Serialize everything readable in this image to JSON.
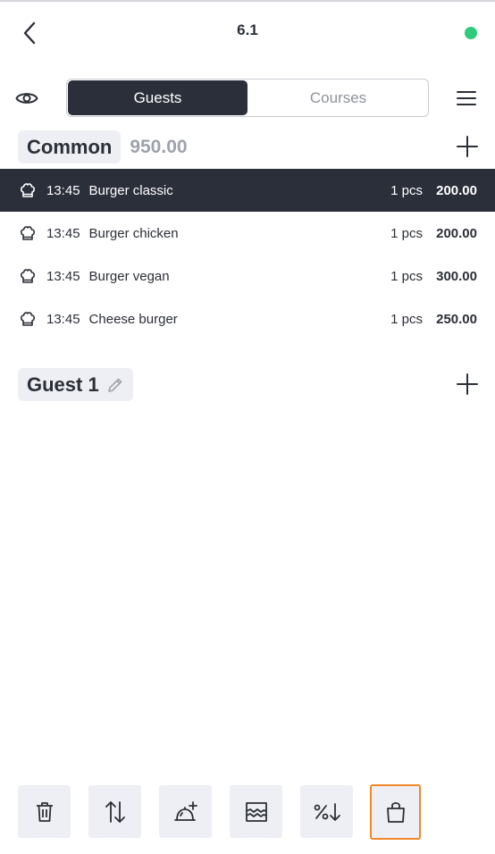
{
  "header": {
    "title": "6.1",
    "status_color": "#2ecc7a"
  },
  "tabs": [
    {
      "label": "Guests",
      "active": true
    },
    {
      "label": "Courses",
      "active": false
    }
  ],
  "common": {
    "label": "Common",
    "total": "950.00",
    "items": [
      {
        "time": "13:45",
        "name": "Burger classic",
        "qty": "1 pcs",
        "price": "200.00",
        "selected": true
      },
      {
        "time": "13:45",
        "name": "Burger chicken",
        "qty": "1 pcs",
        "price": "200.00",
        "selected": false
      },
      {
        "time": "13:45",
        "name": "Burger vegan",
        "qty": "1 pcs",
        "price": "300.00",
        "selected": false
      },
      {
        "time": "13:45",
        "name": "Cheese burger",
        "qty": "1 pcs",
        "price": "250.00",
        "selected": false
      }
    ]
  },
  "guest": {
    "label": "Guest 1"
  },
  "actions": [
    {
      "icon": "trash-icon"
    },
    {
      "icon": "sort-arrows-icon"
    },
    {
      "icon": "add-dish-icon"
    },
    {
      "icon": "split-check-icon"
    },
    {
      "icon": "discount-icon"
    },
    {
      "icon": "bag-icon",
      "highlighted": true
    }
  ],
  "colors": {
    "dark": "#2b2f3a",
    "accent_orange": "#f0882a",
    "status_green": "#2ecc7a",
    "tag_bg": "#eeeff5"
  }
}
